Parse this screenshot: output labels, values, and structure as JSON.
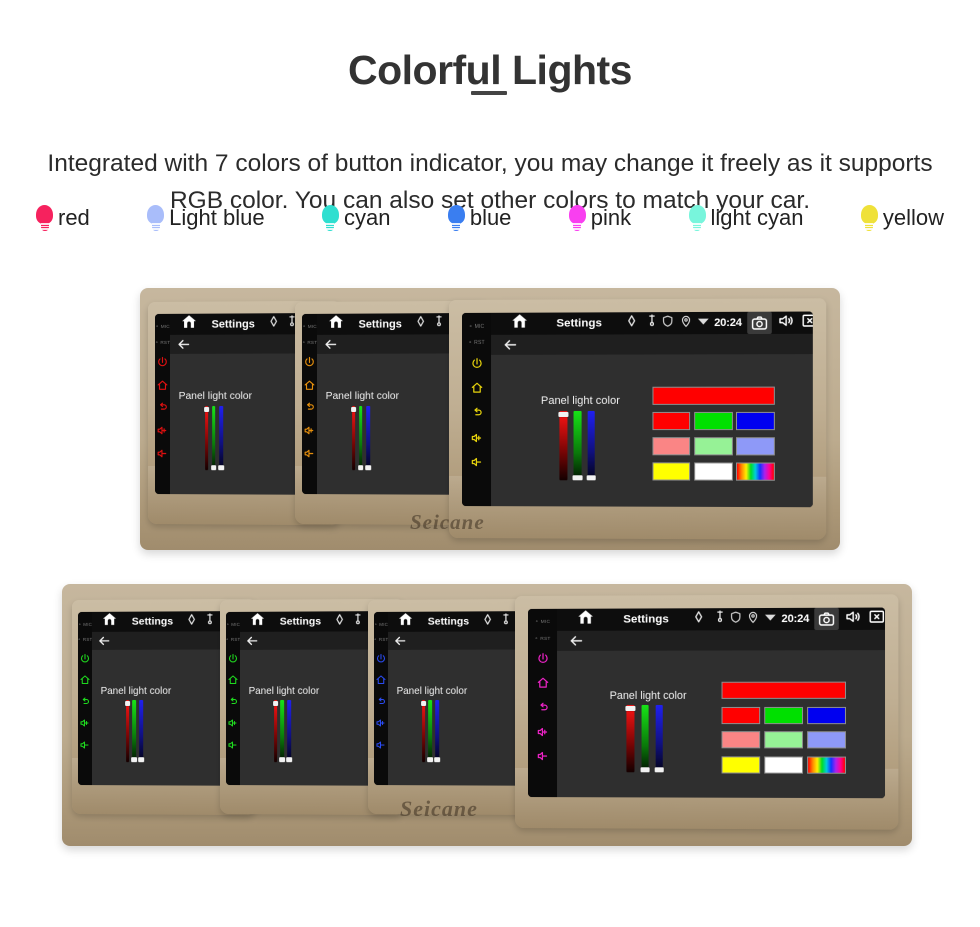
{
  "header": {
    "title": "Colorful Lights",
    "subtitle": "Integrated with 7 colors of button indicator, you may change it freely as it supports RGB color. You can also set other colors to match your car."
  },
  "legend": {
    "items": [
      {
        "label": "red",
        "color": "#f8征"
      },
      {
        "label": "Light blue",
        "color": "#a9bdfa"
      },
      {
        "label": "cyan",
        "color": "#2fdfd0"
      },
      {
        "label": "blue",
        "color": "#3a7ef0"
      },
      {
        "label": "pink",
        "color": "#f93ff0"
      },
      {
        "label": "light cyan",
        "color": "#78f5dc"
      },
      {
        "label": "yellow",
        "color": "#efe139"
      }
    ]
  },
  "device_ui": {
    "statusbar": {
      "home_icon": "home-icon",
      "title": "Settings",
      "left_icons": [
        "navigation-icon",
        "location-pin-icon"
      ],
      "right_icons": [
        "shield-icon",
        "location-icon",
        "wifi-icon"
      ],
      "clock": "20:24",
      "nav_icons": [
        "camera-icon",
        "volume-icon",
        "close-box-icon",
        "recent-apps-icon",
        "back-arrow-icon"
      ]
    },
    "actionbar": {
      "back_icon": "back-arrow-icon"
    },
    "sidebar": {
      "mic_label": "MIC",
      "rst_label": "RST",
      "icons": [
        "power-icon",
        "home-icon",
        "back-icon",
        "volume-up-icon",
        "volume-down-icon"
      ]
    },
    "panel": {
      "slider_label": "Panel light color",
      "sliders": [
        {
          "name": "red",
          "color": "#ff1414",
          "value": 100
        },
        {
          "name": "green",
          "color": "#17e317",
          "value": 0
        },
        {
          "name": "blue",
          "color": "#2020f0",
          "value": 0
        }
      ],
      "preview_color": "#ff0000",
      "swatches": [
        [
          "#ff0000",
          "#00e000",
          "#0000f0"
        ],
        [
          "#fa8585",
          "#96f296",
          "#8e99f8"
        ],
        [
          "#ffff00",
          "#ffffff",
          "rainbow"
        ]
      ]
    },
    "brand_watermark": "Seicane"
  },
  "rows": [
    {
      "name": "row-1",
      "units": [
        {
          "name": "unit-red",
          "accent": "#e01010",
          "full": false
        },
        {
          "name": "unit-orange",
          "accent": "#e8900c",
          "full": false
        },
        {
          "name": "unit-yellow",
          "accent": "#e8d40c",
          "full": true
        }
      ]
    },
    {
      "name": "row-2",
      "units": [
        {
          "name": "unit-green",
          "accent": "#1fdc1f",
          "full": false
        },
        {
          "name": "unit-green-2",
          "accent": "#1fdc1f",
          "full": false
        },
        {
          "name": "unit-blue",
          "accent": "#2a4cf5",
          "full": false
        },
        {
          "name": "unit-magenta",
          "accent": "#ef23c8",
          "full": true
        }
      ]
    }
  ]
}
